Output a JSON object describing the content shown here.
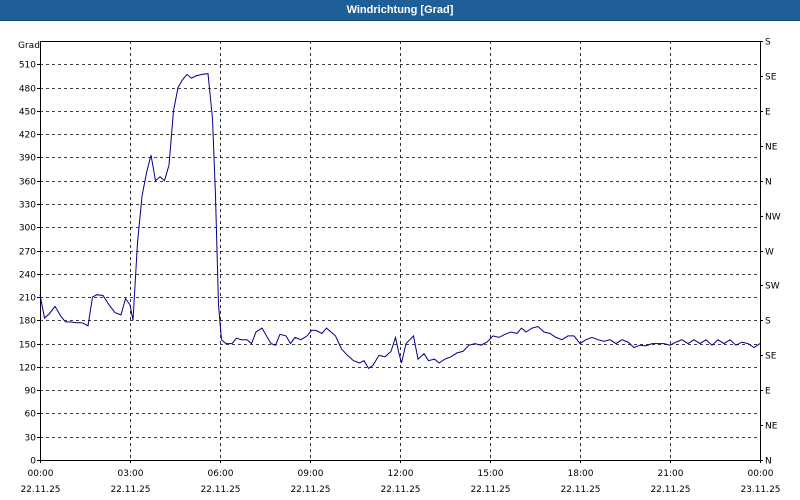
{
  "window": {
    "title": "Windrichtung [Grad]"
  },
  "chart_data": {
    "type": "line",
    "title": "Windrichtung [Grad]",
    "ylabel": "Grad",
    "ylim": [
      0,
      540
    ],
    "yticks": [
      0,
      30,
      60,
      90,
      120,
      150,
      180,
      210,
      240,
      270,
      300,
      330,
      360,
      390,
      420,
      450,
      480,
      510
    ],
    "xlim": [
      0,
      24
    ],
    "xticks": [
      {
        "time": "00:00",
        "date": "22.11.25",
        "h": 0
      },
      {
        "time": "03:00",
        "date": "22.11.25",
        "h": 3
      },
      {
        "time": "06:00",
        "date": "22.11.25",
        "h": 6
      },
      {
        "time": "09:00",
        "date": "22.11.25",
        "h": 9
      },
      {
        "time": "12:00",
        "date": "22.11.25",
        "h": 12
      },
      {
        "time": "15:00",
        "date": "22.11.25",
        "h": 15
      },
      {
        "time": "18:00",
        "date": "22.11.25",
        "h": 18
      },
      {
        "time": "21:00",
        "date": "22.11.25",
        "h": 21
      },
      {
        "time": "00:00",
        "date": "23.11.25",
        "h": 24
      }
    ],
    "right_axis": {
      "labels": [
        {
          "v": 0,
          "t": "N"
        },
        {
          "v": 45,
          "t": "NE"
        },
        {
          "v": 90,
          "t": "E"
        },
        {
          "v": 135,
          "t": "SE"
        },
        {
          "v": 180,
          "t": "S"
        },
        {
          "v": 225,
          "t": "SW"
        },
        {
          "v": 270,
          "t": "W"
        },
        {
          "v": 315,
          "t": "NW"
        },
        {
          "v": 360,
          "t": "N"
        },
        {
          "v": 405,
          "t": "NE"
        },
        {
          "v": 450,
          "t": "E"
        },
        {
          "v": 495,
          "t": "SE"
        },
        {
          "v": 540,
          "t": "S"
        }
      ]
    },
    "grid": true,
    "series": [
      {
        "color": "#00008b",
        "points": [
          [
            0,
            213
          ],
          [
            0.15,
            183
          ],
          [
            0.3,
            188
          ],
          [
            0.5,
            198
          ],
          [
            0.7,
            185
          ],
          [
            0.85,
            178
          ],
          [
            1.0,
            178
          ],
          [
            1.2,
            177
          ],
          [
            1.4,
            177
          ],
          [
            1.6,
            173
          ],
          [
            1.75,
            210
          ],
          [
            1.9,
            213
          ],
          [
            2.1,
            212
          ],
          [
            2.3,
            200
          ],
          [
            2.5,
            190
          ],
          [
            2.7,
            187
          ],
          [
            2.85,
            208
          ],
          [
            3.0,
            200
          ],
          [
            3.1,
            180
          ],
          [
            3.25,
            280
          ],
          [
            3.4,
            340
          ],
          [
            3.55,
            370
          ],
          [
            3.7,
            393
          ],
          [
            3.85,
            360
          ],
          [
            4.0,
            365
          ],
          [
            4.15,
            360
          ],
          [
            4.3,
            380
          ],
          [
            4.45,
            450
          ],
          [
            4.6,
            480
          ],
          [
            4.75,
            490
          ],
          [
            4.9,
            497
          ],
          [
            5.05,
            492
          ],
          [
            5.2,
            495
          ],
          [
            5.4,
            497
          ],
          [
            5.6,
            498
          ],
          [
            5.75,
            440
          ],
          [
            5.85,
            340
          ],
          [
            5.95,
            200
          ],
          [
            6.05,
            155
          ],
          [
            6.2,
            150
          ],
          [
            6.4,
            150
          ],
          [
            6.55,
            157
          ],
          [
            6.7,
            155
          ],
          [
            6.9,
            155
          ],
          [
            7.05,
            150
          ],
          [
            7.2,
            165
          ],
          [
            7.4,
            170
          ],
          [
            7.55,
            160
          ],
          [
            7.7,
            150
          ],
          [
            7.85,
            148
          ],
          [
            8.0,
            162
          ],
          [
            8.2,
            160
          ],
          [
            8.35,
            150
          ],
          [
            8.5,
            158
          ],
          [
            8.7,
            155
          ],
          [
            8.9,
            160
          ],
          [
            9.05,
            167
          ],
          [
            9.2,
            167
          ],
          [
            9.4,
            163
          ],
          [
            9.55,
            170
          ],
          [
            9.7,
            165
          ],
          [
            9.85,
            160
          ],
          [
            10.05,
            143
          ],
          [
            10.25,
            135
          ],
          [
            10.45,
            128
          ],
          [
            10.65,
            125
          ],
          [
            10.8,
            128
          ],
          [
            10.95,
            118
          ],
          [
            11.1,
            122
          ],
          [
            11.3,
            135
          ],
          [
            11.5,
            133
          ],
          [
            11.7,
            140
          ],
          [
            11.85,
            158
          ],
          [
            11.95,
            140
          ],
          [
            12.05,
            125
          ],
          [
            12.2,
            150
          ],
          [
            12.45,
            160
          ],
          [
            12.6,
            130
          ],
          [
            12.8,
            137
          ],
          [
            12.95,
            128
          ],
          [
            13.15,
            130
          ],
          [
            13.3,
            125
          ],
          [
            13.5,
            130
          ],
          [
            13.7,
            133
          ],
          [
            13.9,
            138
          ],
          [
            14.1,
            140
          ],
          [
            14.3,
            148
          ],
          [
            14.5,
            150
          ],
          [
            14.7,
            148
          ],
          [
            14.9,
            152
          ],
          [
            15.1,
            160
          ],
          [
            15.3,
            158
          ],
          [
            15.5,
            162
          ],
          [
            15.7,
            165
          ],
          [
            15.9,
            163
          ],
          [
            16.05,
            170
          ],
          [
            16.2,
            165
          ],
          [
            16.4,
            170
          ],
          [
            16.6,
            172
          ],
          [
            16.8,
            165
          ],
          [
            17.0,
            163
          ],
          [
            17.2,
            158
          ],
          [
            17.4,
            155
          ],
          [
            17.6,
            160
          ],
          [
            17.8,
            160
          ],
          [
            18.0,
            150
          ],
          [
            18.2,
            155
          ],
          [
            18.4,
            158
          ],
          [
            18.6,
            155
          ],
          [
            18.8,
            153
          ],
          [
            19.0,
            155
          ],
          [
            19.2,
            150
          ],
          [
            19.4,
            155
          ],
          [
            19.6,
            152
          ],
          [
            19.8,
            145
          ],
          [
            20.0,
            148
          ],
          [
            20.2,
            147
          ],
          [
            20.4,
            150
          ],
          [
            20.6,
            150
          ],
          [
            20.8,
            150
          ],
          [
            21.0,
            148
          ],
          [
            21.2,
            152
          ],
          [
            21.4,
            155
          ],
          [
            21.6,
            150
          ],
          [
            21.8,
            155
          ],
          [
            22.0,
            150
          ],
          [
            22.2,
            155
          ],
          [
            22.4,
            148
          ],
          [
            22.6,
            155
          ],
          [
            22.8,
            150
          ],
          [
            23.0,
            155
          ],
          [
            23.2,
            148
          ],
          [
            23.4,
            152
          ],
          [
            23.6,
            150
          ],
          [
            23.8,
            145
          ],
          [
            24.0,
            150
          ]
        ]
      }
    ]
  }
}
